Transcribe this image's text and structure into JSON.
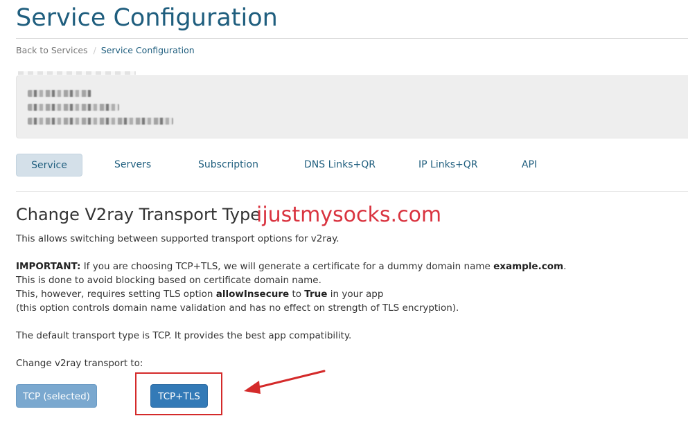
{
  "header": {
    "title": "Service Configuration"
  },
  "breadcrumb": {
    "back_label": "Back to Services",
    "separator": "/",
    "current_label": "Service Configuration"
  },
  "tabs": [
    {
      "label": "Service",
      "active": true
    },
    {
      "label": "Servers",
      "active": false
    },
    {
      "label": "Subscription",
      "active": false
    },
    {
      "label": "DNS Links+QR",
      "active": false
    },
    {
      "label": "IP Links+QR",
      "active": false
    },
    {
      "label": "API",
      "active": false
    }
  ],
  "section": {
    "title": "Change V2ray Transport Type",
    "watermark": "ijustmysocks.com",
    "intro": "This allows switching between supported transport options for v2ray.",
    "important_label": "IMPORTANT:",
    "important_text_1": " If you are choosing TCP+TLS, we will generate a certificate for a dummy domain name ",
    "important_domain": "example.com",
    "important_text_1_end": ".",
    "line_2": "This is done to avoid blocking based on certificate domain name.",
    "line_3_a": "This, however, requires setting TLS option ",
    "line_3_option": "allowInsecure",
    "line_3_b": " to ",
    "line_3_value": "True",
    "line_3_c": " in your app",
    "line_4": "(this option controls domain name validation and has no effect on strength of TLS encryption).",
    "default_text": "The default transport type is TCP. It provides the best app compatibility.",
    "change_prompt": "Change v2ray transport to:"
  },
  "buttons": {
    "tcp_label": "TCP (selected)",
    "tls_label": "TCP+TLS"
  },
  "colors": {
    "title": "#1f5e7e",
    "watermark": "#d9333f",
    "primary_button": "#337ab7",
    "selected_button": "#7aa8cf",
    "highlight": "#d42a2a"
  }
}
